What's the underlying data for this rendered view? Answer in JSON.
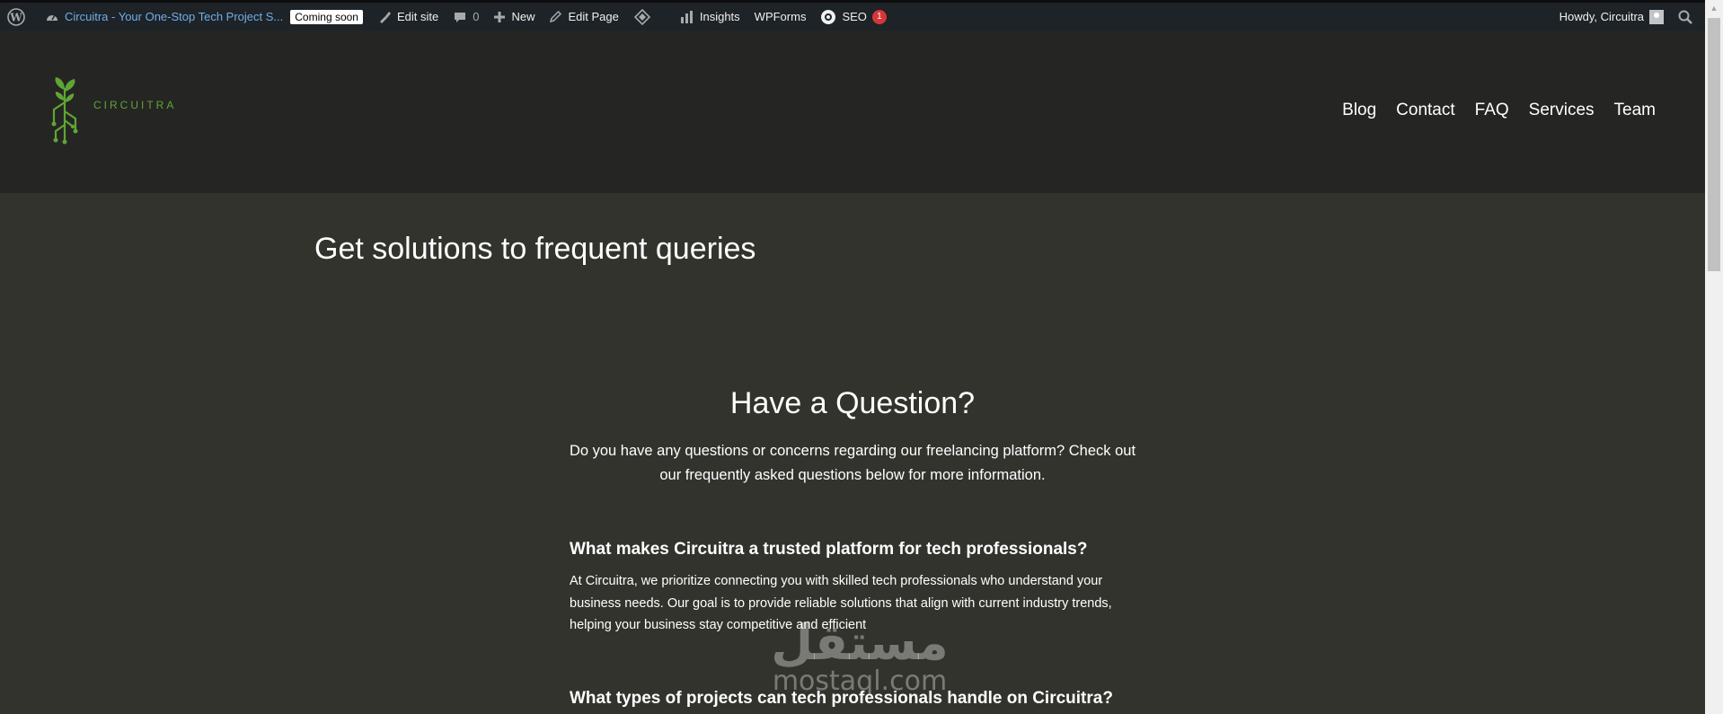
{
  "admin_bar": {
    "site_name": "Circuitra - Your One-Stop Tech Project S...",
    "coming_soon": "Coming soon",
    "edit_site": "Edit site",
    "comments_count": "0",
    "new_label": "New",
    "edit_page": "Edit Page",
    "insights": "Insights",
    "wpforms": "WPForms",
    "seo": "SEO",
    "seo_count": "1",
    "howdy": "Howdy, Circuitra"
  },
  "header": {
    "logo_text": "CIRCUITRA",
    "logo_color": "#5fa536",
    "nav": [
      "Blog",
      "Contact",
      "FAQ",
      "Services",
      "Team"
    ]
  },
  "main": {
    "page_title": "Get solutions to frequent queries",
    "faq_title": "Have a Question?",
    "faq_intro": "Do you have any questions or concerns regarding our freelancing platform? Check out our frequently asked questions below for more information.",
    "faqs": [
      {
        "question": "What makes Circuitra a trusted platform for tech professionals?",
        "answer": "At Circuitra, we prioritize connecting you with skilled tech professionals who understand your business needs. Our goal is to provide reliable solutions that align with current industry trends, helping your business stay competitive and efficient"
      },
      {
        "question": "What types of projects can tech professionals handle on Circuitra?",
        "answer": ""
      }
    ]
  },
  "watermark": {
    "arabic": "مستقل",
    "latin": "mostaql.com"
  }
}
